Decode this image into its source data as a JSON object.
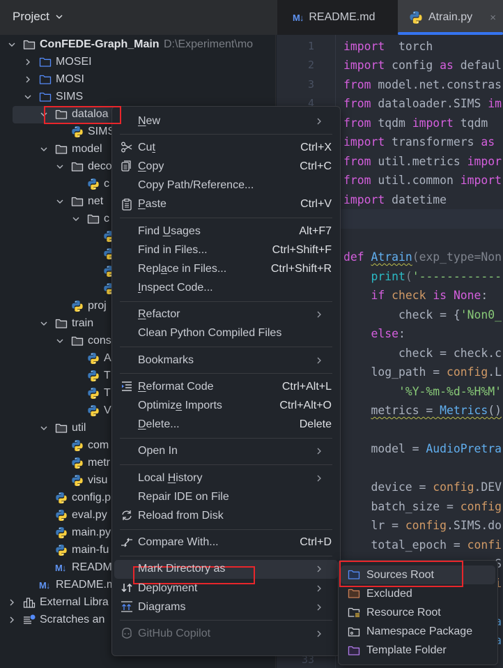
{
  "header": {
    "panel_title": "Project"
  },
  "tabs": [
    {
      "label": "README.md",
      "icon": "markdown-icon",
      "active": false
    },
    {
      "label": "Atrain.py",
      "icon": "python-icon",
      "active": true,
      "close": "×"
    }
  ],
  "tree": [
    {
      "level": 0,
      "type": "folder",
      "open": true,
      "label": "ConFEDE-Graph_Main",
      "path": "D:\\Experiment\\mo"
    },
    {
      "level": 1,
      "type": "folder-blue",
      "open": false,
      "label": "MOSEI"
    },
    {
      "level": 1,
      "type": "folder-blue",
      "open": false,
      "label": "MOSI"
    },
    {
      "level": 1,
      "type": "folder-blue",
      "open": true,
      "label": "SIMS"
    },
    {
      "level": 2,
      "type": "folder",
      "open": true,
      "label": "dataloa",
      "selected": true
    },
    {
      "level": 3,
      "type": "py",
      "label": "SIMS"
    },
    {
      "level": 2,
      "type": "folder",
      "open": true,
      "label": "model"
    },
    {
      "level": 3,
      "type": "folder",
      "open": true,
      "label": "deco"
    },
    {
      "level": 4,
      "type": "py",
      "label": "c"
    },
    {
      "level": 3,
      "type": "folder",
      "open": true,
      "label": "net"
    },
    {
      "level": 4,
      "type": "folder",
      "open": true,
      "label": "c"
    },
    {
      "level": 5,
      "type": "py",
      "label": ""
    },
    {
      "level": 5,
      "type": "py",
      "label": ""
    },
    {
      "level": 5,
      "type": "py",
      "label": ""
    },
    {
      "level": 5,
      "type": "py",
      "label": ""
    },
    {
      "level": 3,
      "type": "py",
      "label": "proj"
    },
    {
      "level": 2,
      "type": "folder",
      "open": true,
      "label": "train"
    },
    {
      "level": 3,
      "type": "folder",
      "open": true,
      "label": "cons"
    },
    {
      "level": 4,
      "type": "py",
      "label": "A"
    },
    {
      "level": 4,
      "type": "py",
      "label": "T"
    },
    {
      "level": 4,
      "type": "py",
      "label": "T"
    },
    {
      "level": 4,
      "type": "py",
      "label": "V"
    },
    {
      "level": 2,
      "type": "folder",
      "open": true,
      "label": "util"
    },
    {
      "level": 3,
      "type": "py",
      "label": "com"
    },
    {
      "level": 3,
      "type": "py",
      "label": "metr"
    },
    {
      "level": 3,
      "type": "py",
      "label": "visu"
    },
    {
      "level": 2,
      "type": "py",
      "label": "config.p"
    },
    {
      "level": 2,
      "type": "py",
      "label": "eval.py"
    },
    {
      "level": 2,
      "type": "py",
      "label": "main.py"
    },
    {
      "level": 2,
      "type": "py",
      "label": "main-fu"
    },
    {
      "level": 2,
      "type": "md",
      "label": "READM"
    },
    {
      "level": 1,
      "type": "md",
      "label": "README.m"
    },
    {
      "level": 0,
      "type": "library",
      "open": false,
      "label": "External Libra"
    },
    {
      "level": 0,
      "type": "scratch",
      "open": false,
      "label": "Scratches an"
    }
  ],
  "code": {
    "current_line": 10,
    "lines": [
      [
        [
          "k",
          "import"
        ],
        [
          "",
          "  torch"
        ]
      ],
      [
        [
          "k",
          "import"
        ],
        [
          "",
          " config "
        ],
        [
          "k",
          "as"
        ],
        [
          "",
          " defaul"
        ]
      ],
      [
        [
          "k",
          "from"
        ],
        [
          "",
          " model.net.constras"
        ]
      ],
      [
        [
          "k",
          "from"
        ],
        [
          "",
          " dataloader.SIMS "
        ],
        [
          "k",
          "im"
        ]
      ],
      [
        [
          "k",
          "from"
        ],
        [
          "",
          " tqdm "
        ],
        [
          "k",
          "import"
        ],
        [
          "",
          " tqdm"
        ]
      ],
      [
        [
          "k",
          "import"
        ],
        [
          "",
          " transformers "
        ],
        [
          "k",
          "as"
        ]
      ],
      [
        [
          "k",
          "from"
        ],
        [
          "",
          " util.metrics "
        ],
        [
          "k",
          "impor"
        ]
      ],
      [
        [
          "k",
          "from"
        ],
        [
          "",
          " util.common "
        ],
        [
          "k",
          "import"
        ]
      ],
      [
        [
          "k",
          "import"
        ],
        [
          "",
          " datetime"
        ]
      ],
      [],
      [],
      [
        [
          "k",
          "def"
        ],
        [
          "",
          " "
        ],
        [
          "f wavy",
          "Atrain"
        ],
        [
          "p",
          "(exp_type=Non"
        ]
      ],
      [
        [
          "",
          "    "
        ],
        [
          "b",
          "print"
        ],
        [
          "p",
          "("
        ],
        [
          "s",
          "'------------"
        ]
      ],
      [
        [
          "",
          "    "
        ],
        [
          "k",
          "if"
        ],
        [
          "o",
          " check "
        ],
        [
          "k",
          "is"
        ],
        [
          "",
          " "
        ],
        [
          "k",
          "None"
        ],
        [
          "",
          ":"
        ]
      ],
      [
        [
          "",
          "        check = {"
        ],
        [
          "s",
          "'Non0_"
        ]
      ],
      [
        [
          "",
          "    "
        ],
        [
          "k",
          "else"
        ],
        [
          "",
          ":"
        ]
      ],
      [
        [
          "",
          "        check = check.c"
        ]
      ],
      [
        [
          "",
          "    log_path = "
        ],
        [
          "o",
          "config"
        ],
        [
          "",
          ".L"
        ]
      ],
      [
        [
          "",
          "        "
        ],
        [
          "s",
          "'%Y-%m-%d-%H%M'"
        ]
      ],
      [
        [
          "",
          "    "
        ],
        [
          "wavy",
          "metrics = "
        ],
        [
          "f wavy",
          "Metrics"
        ],
        [
          "wavy",
          "()"
        ]
      ],
      [],
      [
        [
          "",
          "    model = "
        ],
        [
          "f",
          "AudioPretra"
        ]
      ],
      [],
      [
        [
          "",
          "    device = "
        ],
        [
          "o",
          "config"
        ],
        [
          "",
          ".DEV"
        ]
      ],
      [
        [
          "",
          "    batch_size = "
        ],
        [
          "o",
          "config"
        ]
      ],
      [
        [
          "",
          "    lr = "
        ],
        [
          "o",
          "config"
        ],
        [
          "",
          ".SIMS.do"
        ]
      ],
      [
        [
          "",
          "    total_epoch = "
        ],
        [
          "o",
          "confi"
        ]
      ],
      [
        [
          "",
          "                      S"
        ]
      ],
      [
        [
          "o",
          "                      i"
        ]
      ],
      [],
      [
        [
          "f",
          "                      a"
        ]
      ],
      [
        [
          "f",
          "                      a"
        ]
      ],
      []
    ]
  },
  "context_menu": [
    {
      "label": "New",
      "u": 0,
      "submenu": true
    },
    {
      "sep": true
    },
    {
      "label": "Cut",
      "u": 2,
      "shortcut": "Ctrl+X",
      "icon": "scissors-icon"
    },
    {
      "label": "Copy",
      "u": 0,
      "shortcut": "Ctrl+C",
      "icon": "copy-icon"
    },
    {
      "label": "Copy Path/Reference..."
    },
    {
      "label": "Paste",
      "u": 0,
      "shortcut": "Ctrl+V",
      "icon": "clipboard-icon"
    },
    {
      "sep": true
    },
    {
      "label": "Find Usages",
      "u": 5,
      "shortcut": "Alt+F7"
    },
    {
      "label": "Find in Files...",
      "shortcut": "Ctrl+Shift+F"
    },
    {
      "label": "Replace in Files...",
      "u": 4,
      "shortcut": "Ctrl+Shift+R"
    },
    {
      "label": "Inspect Code...",
      "u": 0
    },
    {
      "sep": true
    },
    {
      "label": "Refactor",
      "u": 0,
      "submenu": true
    },
    {
      "label": "Clean Python Compiled Files"
    },
    {
      "sep": true
    },
    {
      "label": "Bookmarks",
      "submenu": true
    },
    {
      "sep": true
    },
    {
      "label": "Reformat Code",
      "u": 0,
      "shortcut": "Ctrl+Alt+L",
      "icon": "reformat-icon"
    },
    {
      "label": "Optimize Imports",
      "u": 7,
      "shortcut": "Ctrl+Alt+O"
    },
    {
      "label": "Delete...",
      "u": 0,
      "shortcut": "Delete"
    },
    {
      "sep": true
    },
    {
      "label": "Open In",
      "submenu": true
    },
    {
      "sep": true
    },
    {
      "label": "Local History",
      "u": 6,
      "submenu": true
    },
    {
      "label": "Repair IDE on File"
    },
    {
      "label": "Reload from Disk",
      "icon": "reload-icon"
    },
    {
      "sep": true
    },
    {
      "label": "Compare With...",
      "shortcut": "Ctrl+D",
      "icon": "compare-icon"
    },
    {
      "sep": true
    },
    {
      "label": "Mark Directory as",
      "submenu": true,
      "highlighted": true
    },
    {
      "label": "Deployment",
      "submenu": true,
      "icon": "deployment-icon"
    },
    {
      "label": "Diagrams",
      "submenu": true,
      "icon": "diagrams-icon"
    },
    {
      "sep": true
    },
    {
      "label": "GitHub Copilot",
      "submenu": true,
      "icon": "copilot-icon",
      "disabled": true
    }
  ],
  "mark_directory_submenu": [
    {
      "label": "Sources Root",
      "icon": "folder-sources-icon",
      "color": "#548af7",
      "highlighted": true
    },
    {
      "label": "Excluded",
      "icon": "folder-excluded-icon",
      "color": "#c77d55"
    },
    {
      "label": "Resource Root",
      "icon": "folder-resource-icon",
      "color": "#ced0d6"
    },
    {
      "label": "Namespace Package",
      "icon": "folder-namespace-icon",
      "color": "#ced0d6"
    },
    {
      "label": "Template Folder",
      "icon": "folder-template-icon",
      "color": "#b07ae8"
    }
  ],
  "colors": {
    "accent": "#3574f0",
    "highlight_box": "#e8262b",
    "keyword": "#d55fde",
    "function": "#61afef",
    "string": "#89ca78"
  }
}
